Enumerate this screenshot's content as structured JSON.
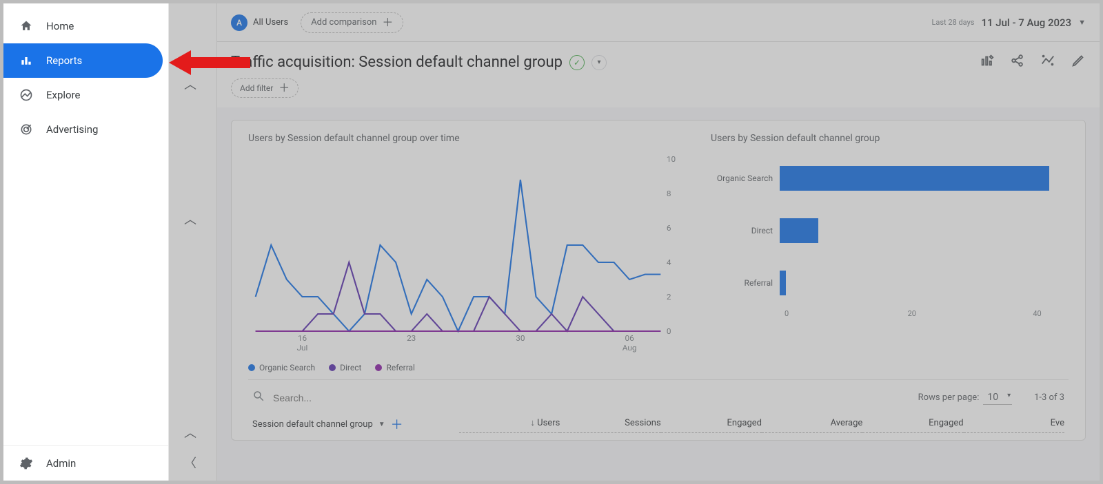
{
  "sidebar": {
    "items": [
      {
        "label": "Home"
      },
      {
        "label": "Reports"
      },
      {
        "label": "Explore"
      },
      {
        "label": "Advertising"
      }
    ],
    "admin": "Admin"
  },
  "topbar": {
    "audience_badge": "A",
    "audience_label": "All Users",
    "add_comparison": "Add comparison",
    "date_label": "Last 28 days",
    "date_range": "11 Jul - 7 Aug 2023"
  },
  "page": {
    "title": "Traffic acquisition: Session default channel group",
    "add_filter": "Add filter"
  },
  "charts": {
    "line_title": "Users by Session default channel group over time",
    "bar_title": "Users by Session default channel group",
    "legend": [
      "Organic Search",
      "Direct",
      "Referral"
    ]
  },
  "chart_data": {
    "line": {
      "type": "line",
      "ylim": [
        0,
        10
      ],
      "yticks": [
        0,
        2,
        4,
        6,
        8,
        10
      ],
      "x_labels": [
        {
          "pos": 3,
          "top": "16",
          "bottom": "Jul"
        },
        {
          "pos": 10,
          "top": "23",
          "bottom": ""
        },
        {
          "pos": 17,
          "top": "30",
          "bottom": ""
        },
        {
          "pos": 24,
          "top": "06",
          "bottom": "Aug"
        }
      ],
      "series": [
        {
          "name": "Organic Search",
          "color": "#1a73e8",
          "values": [
            2,
            5,
            3,
            2,
            2,
            1,
            0,
            1,
            5,
            4,
            1,
            3,
            2,
            0,
            2,
            2,
            1,
            8.8,
            2,
            1,
            5,
            5,
            4,
            4,
            3,
            3.3,
            3.3
          ]
        },
        {
          "name": "Direct",
          "color": "#5e35b1",
          "values": [
            0,
            0,
            0,
            0,
            1,
            1,
            4,
            1,
            1,
            0,
            0,
            1,
            0,
            0,
            0,
            2,
            1,
            0,
            0,
            1,
            0,
            2,
            1,
            0,
            0,
            0,
            0
          ]
        },
        {
          "name": "Referral",
          "color": "#8e24aa",
          "values": [
            0,
            0,
            0,
            0,
            0,
            0,
            0,
            0,
            0,
            0,
            0,
            0,
            0,
            0,
            0,
            0,
            0,
            0,
            0,
            0,
            0,
            0,
            0,
            0,
            0,
            0,
            0
          ]
        }
      ]
    },
    "bar": {
      "type": "bar",
      "categories": [
        "Organic Search",
        "Direct",
        "Referral"
      ],
      "values": [
        42,
        6,
        1
      ],
      "xlim": [
        0,
        45
      ],
      "xticks": [
        0,
        20,
        40
      ]
    }
  },
  "table": {
    "search_placeholder": "Search...",
    "rows_per_page_label": "Rows per page:",
    "rows_per_page_value": "10",
    "pager": "1-3 of 3",
    "dimension": "Session default channel group",
    "columns": [
      "Users",
      "Sessions",
      "Engaged",
      "Average",
      "Engaged",
      "Eve"
    ]
  }
}
